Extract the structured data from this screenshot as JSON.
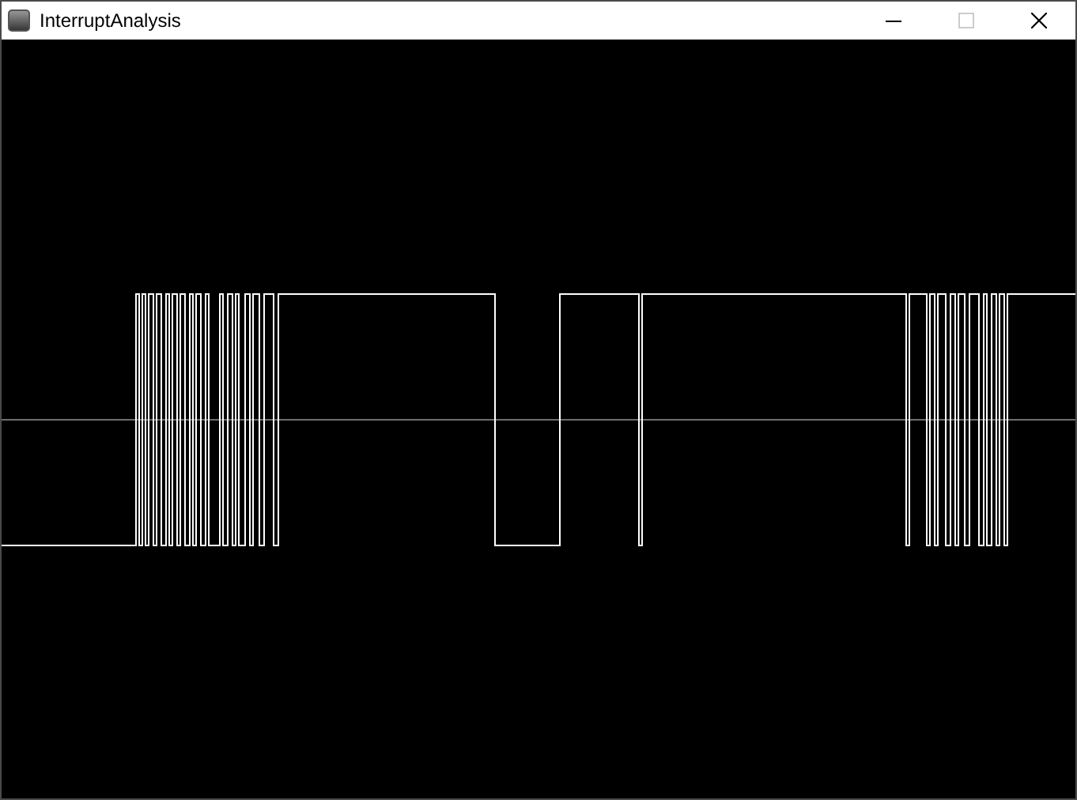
{
  "window": {
    "title": "InterruptAnalysis"
  },
  "controls": [
    {
      "kind": "minimize",
      "disabled": false
    },
    {
      "kind": "maximize",
      "disabled": true
    },
    {
      "kind": "close",
      "disabled": false
    }
  ]
}
